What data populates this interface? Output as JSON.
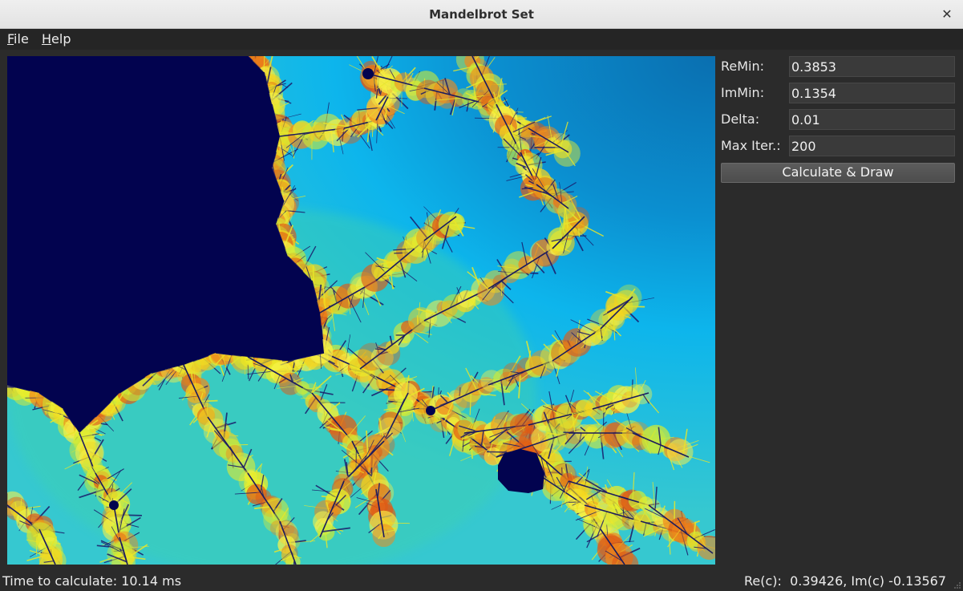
{
  "window": {
    "title": "Mandelbrot Set"
  },
  "menu": {
    "file": {
      "mnemonic": "F",
      "rest": "ile"
    },
    "help": {
      "mnemonic": "H",
      "rest": "elp"
    }
  },
  "panel": {
    "remin_label": "ReMin:",
    "remin_value": "0.3853",
    "immin_label": "ImMin:",
    "immin_value": "0.1354",
    "delta_label": "Delta:",
    "delta_value": "0.01",
    "maxiter_label": "Max Iter.:",
    "maxiter_value": "200",
    "calc_button": "Calculate & Draw"
  },
  "status": {
    "time_text": "Time to calculate: 10.14 ms",
    "coord_text": "Re(c):  0.39426, Im(c) -0.13567"
  },
  "colors": {
    "set_interior": "#02034f",
    "background_cyan": "#1cb2dc",
    "boundary_yellow": "#e6ec28",
    "boundary_orange": "#f08a1c",
    "outer_blue": "#0a78c0"
  }
}
